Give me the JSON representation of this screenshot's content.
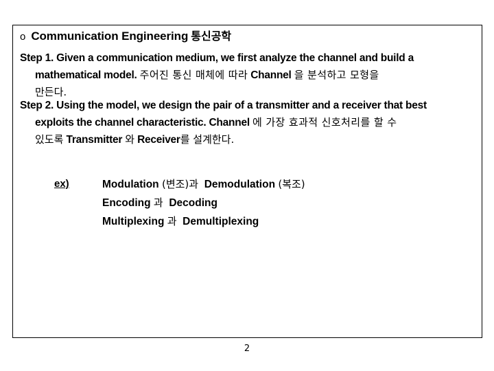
{
  "slide": {
    "heading": {
      "bullet": "o",
      "title_en": "Communication Engineering",
      "title_ko": "통신공학"
    },
    "step1": {
      "line1": "Step 1. Given a communication medium, we first analyze the channel and build a",
      "line2_en_a": "mathematical model.",
      "line2_ko_a": "주어진  통신 매체에 따라",
      "line2_en_b": "Channel",
      "line2_ko_b": "을  분석하고   모형을",
      "line3_ko": "만든다."
    },
    "step2": {
      "line1": "Step 2. Using the model, we design the pair of a transmitter and a receiver that best",
      "line2_en_a": "exploits the channel characteristic. Channel",
      "line2_ko_a": "에  가장  효과적  신호처리를   할 수",
      "line3_ko_a": "있도록",
      "line3_en_a": "Transmitter",
      "line3_ko_b": "와",
      "line3_en_b": "Receiver",
      "line3_ko_c": "를 설계한다."
    },
    "example": {
      "label": "ex)",
      "rows": [
        {
          "en_a": "Modulation",
          "ko_a": "(변조)과",
          "en_b": "Demodulation",
          "ko_b": "(복조)"
        },
        {
          "en_a": "Encoding",
          "ko_a": "과",
          "en_b": "Decoding",
          "ko_b": ""
        },
        {
          "en_a": "Multiplexing",
          "ko_a": "과",
          "en_b": "Demultiplexing",
          "ko_b": ""
        }
      ]
    }
  },
  "page_number": "2"
}
